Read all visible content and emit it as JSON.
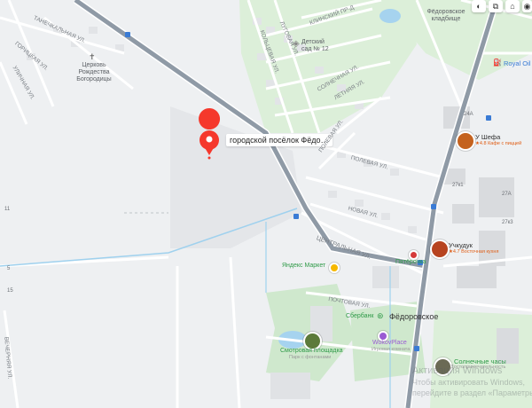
{
  "map": {
    "pin": {
      "label": "городской посёлок Фёдо…"
    },
    "controls": [
      {
        "name": "night-mode-icon",
        "glyph": "◐"
      },
      {
        "name": "layers-icon",
        "glyph": "⧉"
      },
      {
        "name": "share-icon",
        "glyph": "⌂"
      },
      {
        "name": "camera-icon",
        "glyph": "◉"
      }
    ],
    "streets": {
      "tanechkalnaya": "ТАНЕЧКАЛЬНАЯ УЛ.",
      "goritskaya": "ГОРИЦКАЯ УЛ.",
      "ulitsa_left": "УЛИЧНАЯ УЛ.",
      "lokniskaya": "КЛИНСКИЙ ПР-Д",
      "kolhoznaya": "КОЛЬЦЕВАЯ УЛ.",
      "lugovaya": "ЛУГОВАЯ УЛ.",
      "yunosti": "ЮНОСТИ УЛ.",
      "solnechnaya": "СОЛНЕЧНАЯ УЛ.",
      "letnyaya": "ЛЕТНЯЯ УЛ.",
      "polevaya": "ПОЛЕВАЯ УЛ.",
      "polevaya2": "ПОЛЕВАЯ УЛ.",
      "novaya": "НОВАЯ УЛ.",
      "centralnaya": "ЦЕНТРАЛЬНАЯ УЛ.",
      "pochtovaya": "ПОЧТОВАЯ УЛ.",
      "vechernyaya": "ВЕЧЕРНЯЯ УЛ."
    },
    "places": {
      "church_line1": "Церковь",
      "church_line2": "Рождества",
      "church_line3": "Богородицы",
      "kindergarten_line1": "Детский",
      "kindergarten_line2": "сад № 12",
      "cemetery_line1": "Фёдоровское",
      "cemetery_line2": "кладбище",
      "royal_oil": "Royal Oil",
      "settlement": "Фёдоровское",
      "sberbank": "Сбербанк",
      "yandex_market": "Яндекс Маркет",
      "pyaterochka": "Пятёрочка",
      "wokov_place": "WokovPlace",
      "wokov_sub": "Игровая комната",
      "observation_deck": "Смотровая площадка",
      "observation_sub": "Парк с фонтанами",
      "sundial": "Солнечные часы",
      "sundial_sub": "Достопримечательность"
    },
    "pois": {
      "u_shefa_name": "У Шефа",
      "u_shefa_rating": "★4.8 Кафе с пиццей",
      "uchkuduk_name": "Учкудук",
      "uchkuduk_rating": "★4.7 Восточная кухня"
    },
    "house_numbers": [
      "24А",
      "27к1",
      "27А",
      "27к3",
      "15",
      "5",
      "11"
    ],
    "watermark": {
      "line1": "Активация Windows",
      "line2": "Чтобы активировать Windows,",
      "line3": "перейдите в раздел «Параметры»."
    }
  }
}
